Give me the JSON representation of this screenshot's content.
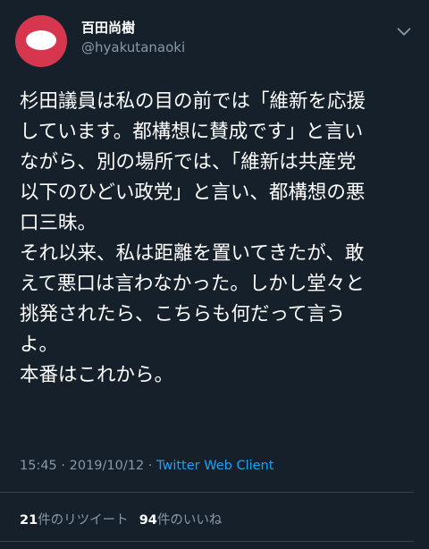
{
  "author": {
    "display_name": "百田尚樹",
    "handle": "@hyakutanaoki"
  },
  "colors": {
    "background": "#15202b",
    "avatar": "#d7374e",
    "secondary_text": "#8899a6",
    "link": "#1da1f2",
    "divider": "#38444d"
  },
  "icons": {
    "menu": "chevron-down-icon"
  },
  "tweet": {
    "text": "杉田議員は私の目の前では「維新を応援\nしています。都構想に賛成です」と言い\nながら、別の場所では、「維新は共産党\n以下のひどい政党」と言い、都構想の悪\n口三昧。\nそれ以来、私は距離を置いてきたが、敢\nえて悪口は言わなかった。しかし堂々と\n挑発されたら、こちらも何だって言う\nよ。\n本番はこれから。"
  },
  "meta": {
    "time": "15:45",
    "date": "2019/10/12",
    "client": "Twitter Web Client"
  },
  "stats": {
    "retweets_count": "21",
    "retweets_label": "件のリツイート",
    "likes_count": "94",
    "likes_label": "件のいいね"
  }
}
